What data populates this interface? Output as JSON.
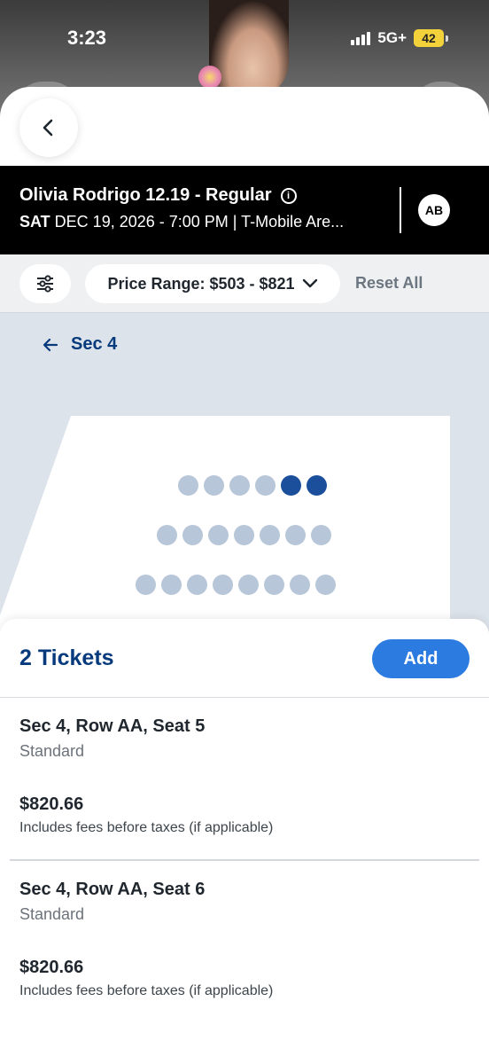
{
  "status_bar": {
    "time": "3:23",
    "network": "5G+",
    "battery": "42"
  },
  "event": {
    "title": "Olivia Rodrigo 12.19 - Regular",
    "day": "SAT",
    "details": " DEC 19, 2026 - 7:00 PM | T-Mobile Are...",
    "avatar_initials": "AB"
  },
  "filters": {
    "price_range_label": "Price Range: $503 - $821",
    "reset_label": "Reset All"
  },
  "map": {
    "section_label": "Sec 4",
    "rows": [
      {
        "seats": [
          "available",
          "available",
          "available",
          "available",
          "selected",
          "selected"
        ]
      },
      {
        "seats": [
          "available",
          "available",
          "available",
          "available",
          "available",
          "available",
          "available"
        ]
      },
      {
        "seats": [
          "available",
          "available",
          "available",
          "available",
          "available",
          "available",
          "available",
          "available"
        ]
      }
    ]
  },
  "cart": {
    "count_label": "2 Tickets",
    "add_label": "Add",
    "tickets": [
      {
        "title": "Sec 4, Row AA, Seat 5",
        "type": "Standard",
        "price": "$820.66",
        "fees_note": "Includes fees before taxes (if applicable)"
      },
      {
        "title": "Sec 4, Row AA, Seat 6",
        "type": "Standard",
        "price": "$820.66",
        "fees_note": "Includes fees before taxes (if applicable)"
      }
    ]
  },
  "colors": {
    "accent": "#2b7be0",
    "brand_navy": "#073a7d",
    "seat_selected": "#1b4f9c",
    "seat_available": "#b7c6d8"
  },
  "icons": {
    "back": "chevron-left-icon",
    "info": "info-icon",
    "filter": "sliders-icon",
    "dropdown": "chevron-down-icon",
    "section_back": "arrow-left-icon"
  }
}
